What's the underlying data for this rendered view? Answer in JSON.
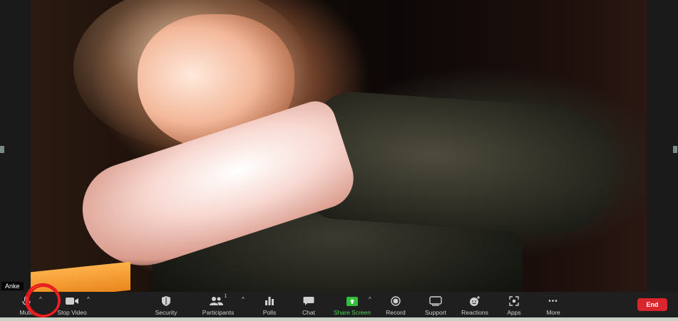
{
  "participant_name": "Anke",
  "toolbar": {
    "mute_label": "Mute",
    "stop_video_label": "Stop Video",
    "security_label": "Security",
    "participants_label": "Participants",
    "participants_count": "1",
    "polls_label": "Polls",
    "chat_label": "Chat",
    "share_screen_label": "Share Screen",
    "record_label": "Record",
    "support_label": "Support",
    "reactions_label": "Reactions",
    "apps_label": "Apps",
    "more_label": "More",
    "more_glyph": "•••",
    "end_label": "End",
    "caret_glyph": "^"
  },
  "icons": {
    "mute": "microphone-icon",
    "video": "video-camera-icon",
    "security": "shield-icon",
    "participants": "people-icon",
    "polls": "bar-chart-icon",
    "chat": "speech-bubble-icon",
    "share": "share-arrow-icon",
    "record": "record-icon",
    "support": "support-screen-icon",
    "reactions": "emoji-plus-icon",
    "apps": "apps-icon"
  },
  "colors": {
    "toolbar_bg": "#1f1f1f",
    "share_green": "#4fd35a",
    "end_red": "#d9262c",
    "annotation_red": "#e5171a"
  }
}
